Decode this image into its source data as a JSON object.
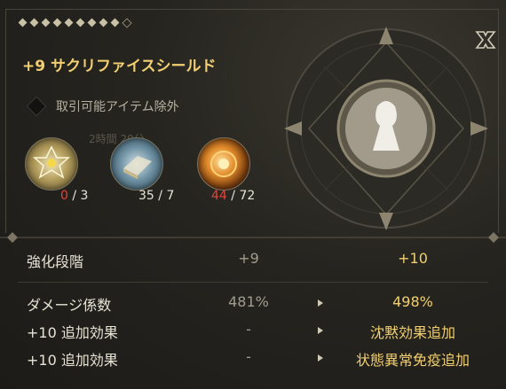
{
  "panel": {
    "gems_filled": 9,
    "close_icon": "close-icon",
    "item_name": "+9 サクリファイスシールド",
    "untradable_label": "取引可能アイテム除外",
    "faded_text": "2時間 20分"
  },
  "materials": [
    {
      "icon": "star-crest-material-icon",
      "have": "0",
      "need": "3",
      "insufficient": true
    },
    {
      "icon": "blue-cloth-material-icon",
      "have": "35",
      "need": "7",
      "insufficient": false
    },
    {
      "icon": "fire-orb-material-icon",
      "have": "44",
      "need": "72",
      "insufficient": true
    }
  ],
  "stats": [
    {
      "label": "強化段階",
      "current": "+9",
      "next": "+10",
      "show_arrow": false
    },
    {
      "label": "ダメージ係数",
      "current": "481%",
      "next": "498%",
      "show_arrow": true
    },
    {
      "label": "+10 追加効果",
      "current": "-",
      "next": "沈黙効果追加",
      "show_arrow": true
    },
    {
      "label": "+10 追加効果",
      "current": "-",
      "next": "状態異常免疫追加",
      "show_arrow": true
    }
  ],
  "colors": {
    "title_gold": "#f1cf72",
    "insufficient_red": "#e2453b"
  }
}
